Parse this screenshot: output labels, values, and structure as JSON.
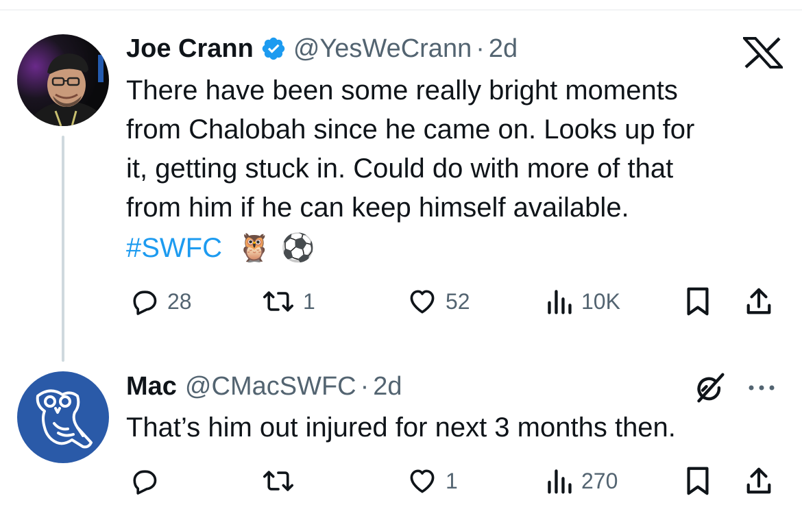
{
  "tweets": [
    {
      "display_name": "Joe Crann",
      "verified": true,
      "handle": "@YesWeCrann",
      "separator": "·",
      "time": "2d",
      "text": "There have been some really bright moments\nfrom Chalobah since he came on. Looks up for\nit, getting stuck in. Could do with more of that\nfrom him if he can keep himself available.",
      "hashtag": "#SWFC",
      "emojis": [
        "🦉",
        "⚽"
      ],
      "reply_count": "28",
      "retweet_count": "1",
      "like_count": "52",
      "view_count": "10K",
      "icons": [
        "reply-icon",
        "retweet-icon",
        "like-icon",
        "views-icon",
        "bookmark-icon",
        "share-icon"
      ]
    },
    {
      "display_name": "Mac",
      "handle": "@CMacSWFC",
      "separator": "·",
      "time": "2d",
      "text": "That’s him out injured for next 3 months then.",
      "reply_count": "",
      "retweet_count": "",
      "like_count": "1",
      "view_count": "270",
      "icons": [
        "reply-icon",
        "retweet-icon",
        "like-icon",
        "views-icon",
        "bookmark-icon",
        "share-icon",
        "grok-icon",
        "more-icon"
      ]
    }
  ],
  "brand": {
    "logo": "x-logo"
  },
  "colors": {
    "text": "#0f1419",
    "secondary": "#536471",
    "accent": "#1d9bf0",
    "verified": "#1d9bf0",
    "thread_line": "#cfd9de",
    "avatar2_bg": "#2a5aa8"
  }
}
